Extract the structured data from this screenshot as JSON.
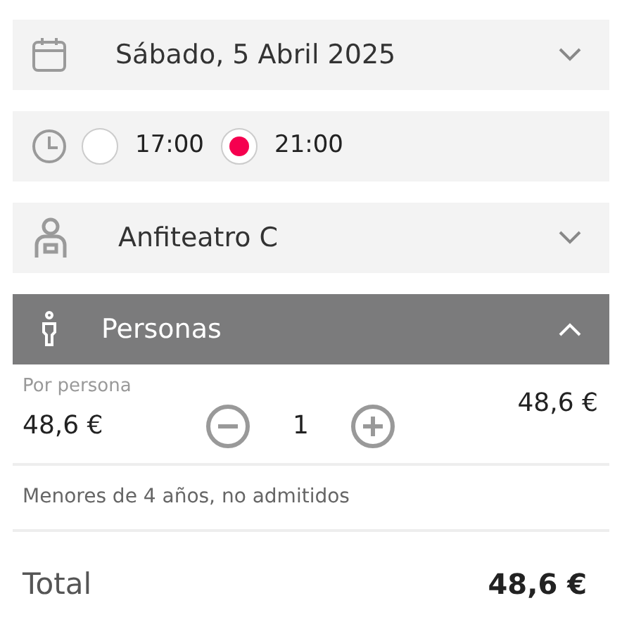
{
  "date_select": {
    "value": "Sábado, 5 Abril 2025",
    "expanded": false
  },
  "times": [
    {
      "label": "17:00",
      "selected": false
    },
    {
      "label": "21:00",
      "selected": true
    }
  ],
  "venue_select": {
    "value": "Anfiteatro C",
    "expanded": false
  },
  "persons_section": {
    "title": "Personas",
    "expanded": true
  },
  "ticket": {
    "label": "Por persona",
    "price": "48,6 €",
    "quantity": "1",
    "subtotal": "48,6 €"
  },
  "note": "Menores de 4 años, no admitidos",
  "total": {
    "label": "Total",
    "value": "48,6 €"
  }
}
